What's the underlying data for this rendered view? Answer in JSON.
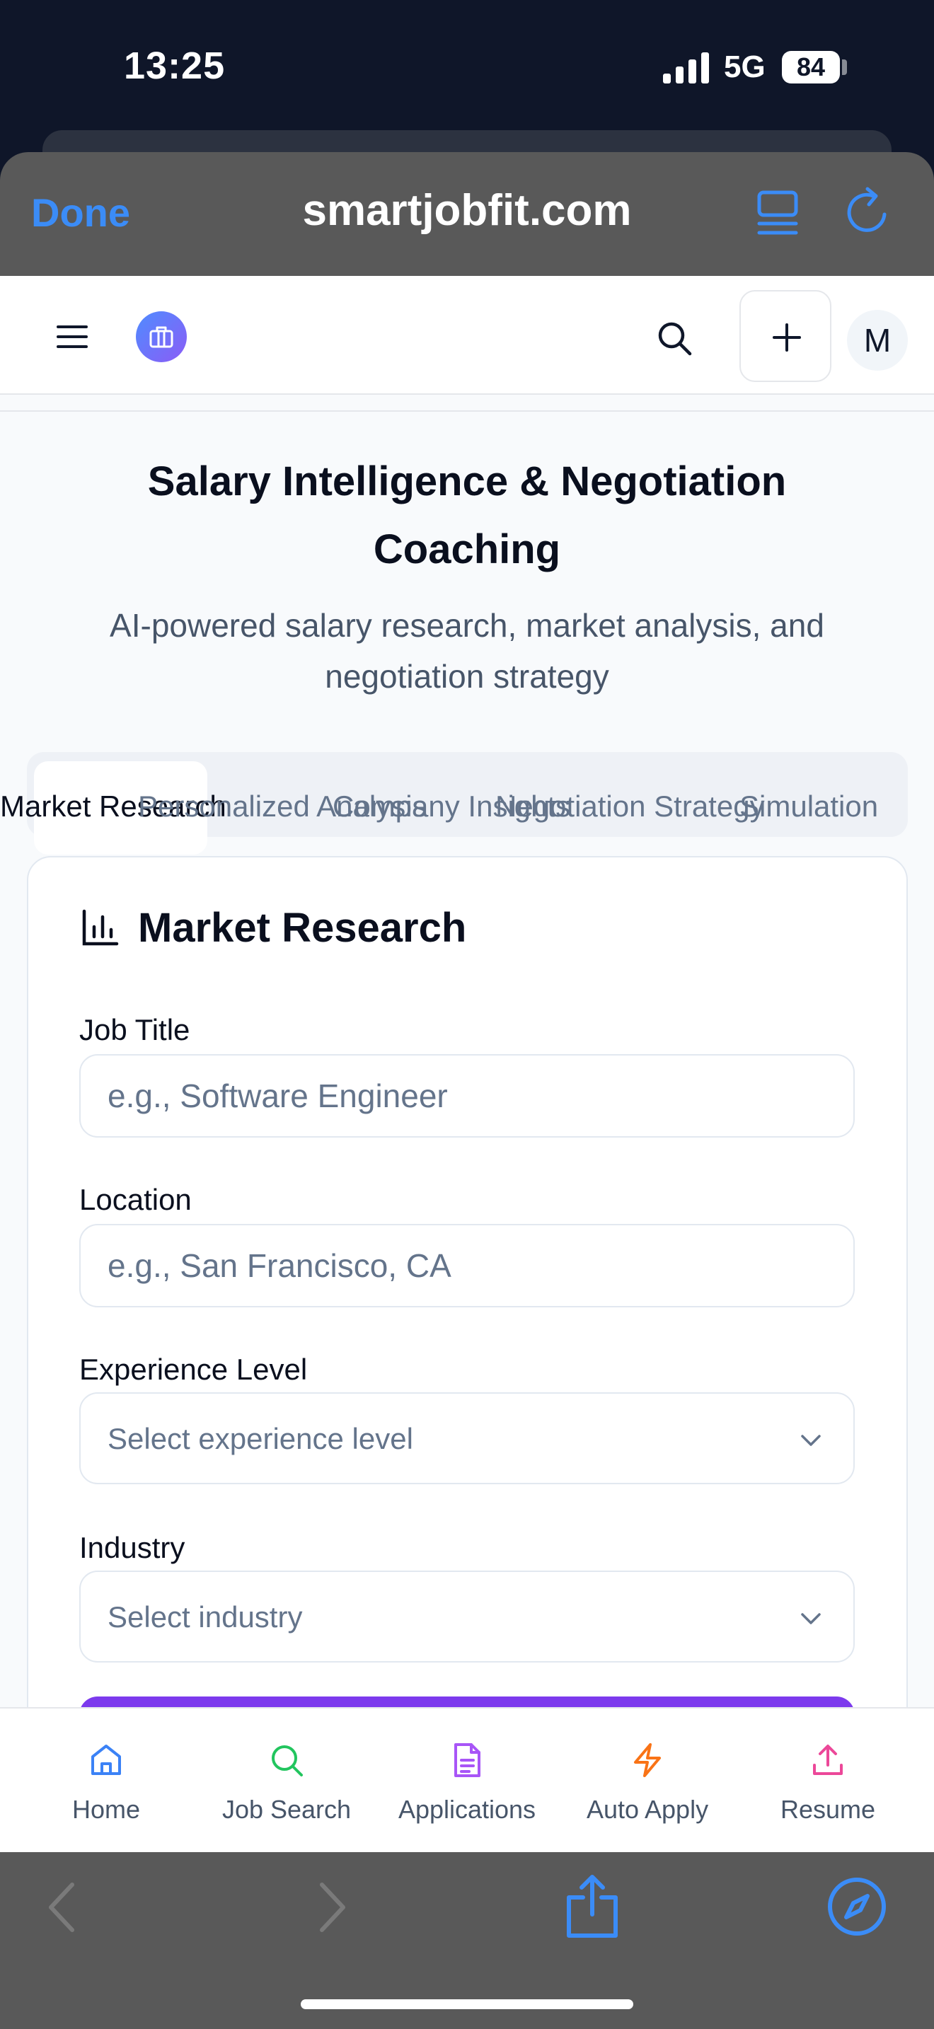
{
  "status_bar": {
    "time": "13:25",
    "network": "5G",
    "battery": "84"
  },
  "browser": {
    "done_label": "Done",
    "url": "smartjobfit.com"
  },
  "header": {
    "avatar_initial": "M"
  },
  "page": {
    "title": "Salary Intelligence & Negotiation Coaching",
    "subtitle": "AI-powered salary research, market analysis, and negotiation strategy"
  },
  "tabs": [
    {
      "label": "Market Research",
      "active": true
    },
    {
      "label": "Personalized Analysis",
      "active": false
    },
    {
      "label": "Company Insights",
      "active": false
    },
    {
      "label": "Negotiation Strategy",
      "active": false
    },
    {
      "label": "Simulation",
      "active": false
    }
  ],
  "card": {
    "title": "Market Research",
    "icon": "bar-chart-icon",
    "fields": {
      "job_title": {
        "label": "Job Title",
        "placeholder": "e.g., Software Engineer"
      },
      "location": {
        "label": "Location",
        "placeholder": "e.g., San Francisco, CA"
      },
      "experience": {
        "label": "Experience Level",
        "placeholder": "Select experience level"
      },
      "industry": {
        "label": "Industry",
        "placeholder": "Select industry"
      }
    }
  },
  "bottom_nav": [
    {
      "label": "Home",
      "icon": "home-icon",
      "color": "#3b82f6"
    },
    {
      "label": "Job Search",
      "icon": "search-icon",
      "color": "#22c55e"
    },
    {
      "label": "Applications",
      "icon": "document-icon",
      "color": "#a855f7"
    },
    {
      "label": "Auto Apply",
      "icon": "lightning-icon",
      "color": "#f97316"
    },
    {
      "label": "Resume",
      "icon": "upload-icon",
      "color": "#ec4899"
    }
  ],
  "colors": {
    "accent_blue": "#3b8cf7",
    "primary_purple": "#7c3aed"
  }
}
